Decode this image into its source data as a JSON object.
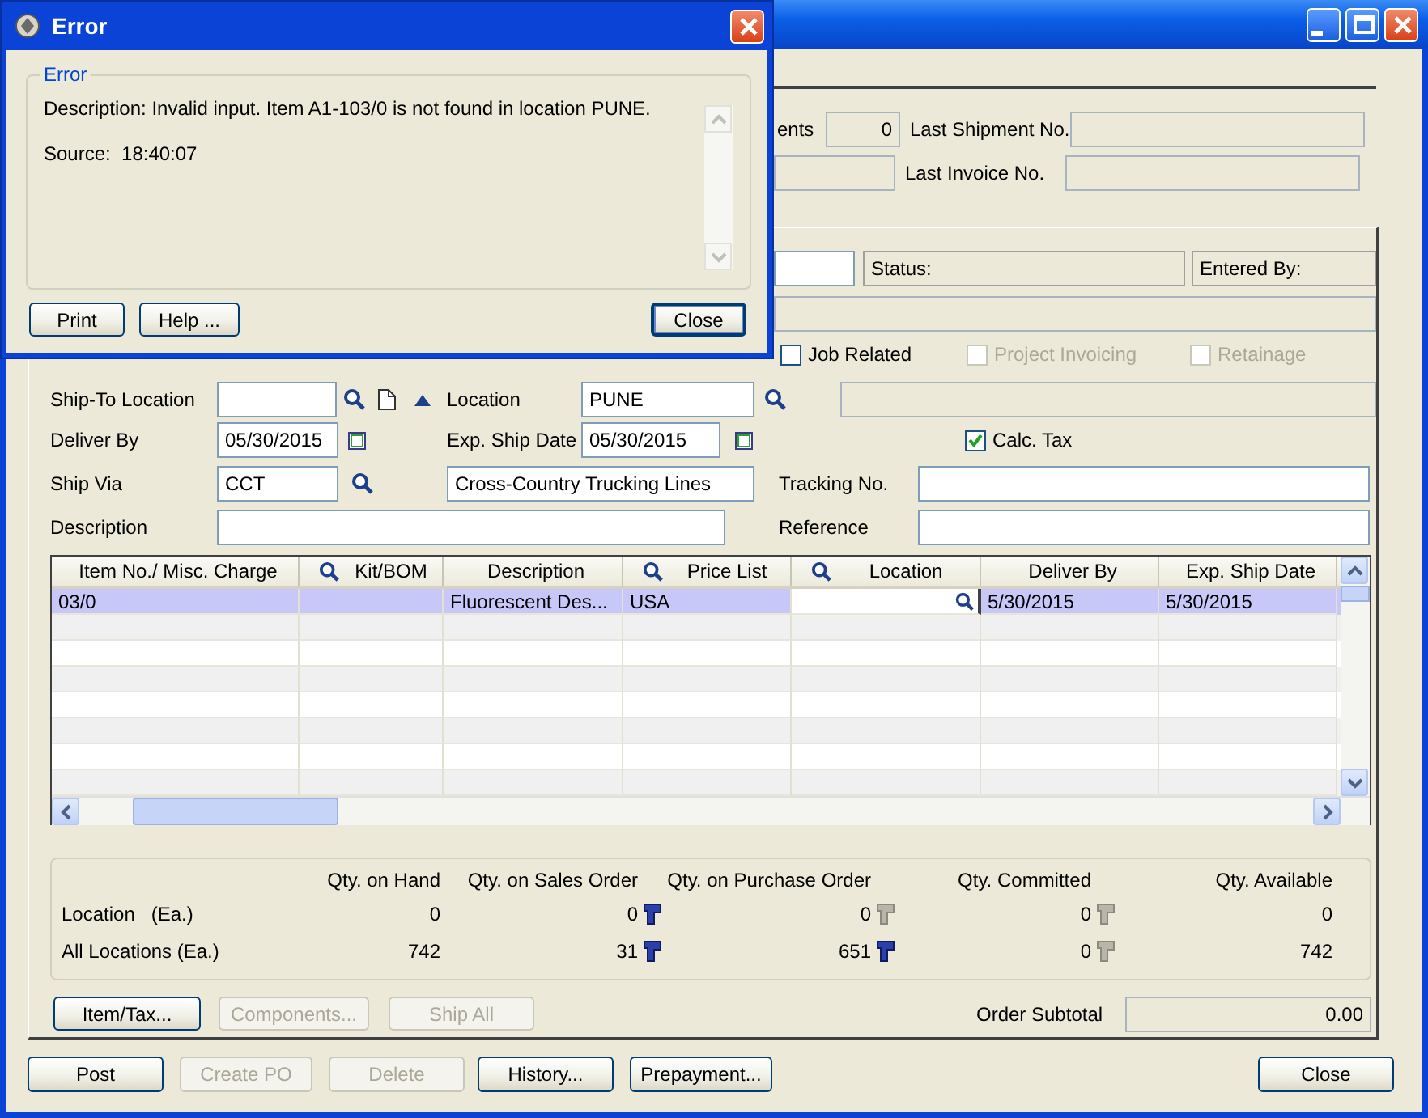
{
  "dialog": {
    "title": "Error",
    "group_title": "Error",
    "description": "Description: Invalid input. Item A1-103/0 is not found in location PUNE.",
    "source": "Source:  18:40:07",
    "buttons": [
      {
        "label": "Print",
        "default": false
      },
      {
        "label": "Help ...",
        "default": false
      },
      {
        "label": "Close",
        "default": true
      }
    ]
  },
  "header": {
    "shipments_label": "ents",
    "shipments_count": "0",
    "last_shipment_label": "Last Shipment No.",
    "last_invoice_label": "Last Invoice No."
  },
  "status_label": "Status:",
  "entered_by_label": "Entered By:",
  "checkboxes": [
    {
      "label": "Job Related",
      "checked": false,
      "disabled": false
    },
    {
      "label": "Project Invoicing",
      "checked": false,
      "disabled": true
    },
    {
      "label": "Retainage",
      "checked": false,
      "disabled": true
    }
  ],
  "ship_to_location": {
    "label": "Ship-To Location"
  },
  "location": {
    "label": "Location",
    "value": "PUNE"
  },
  "deliver_by": {
    "label": "Deliver By",
    "value": "05/30/2015"
  },
  "exp_ship_date": {
    "label": "Exp. Ship Date",
    "value": "05/30/2015"
  },
  "calc_tax": {
    "label": "Calc. Tax",
    "checked": true
  },
  "ship_via": {
    "label": "Ship Via",
    "value": "CCT",
    "name": "Cross-Country Trucking Lines"
  },
  "tracking_no": {
    "label": "Tracking No."
  },
  "description": {
    "label": "Description"
  },
  "reference": {
    "label": "Reference"
  },
  "grid": {
    "columns": [
      {
        "label": "Item No./ Misc. Charge",
        "search": false
      },
      {
        "label": "Kit/BOM",
        "search": true
      },
      {
        "label": "Description",
        "search": false
      },
      {
        "label": "Price List",
        "search": true
      },
      {
        "label": "Location",
        "search": true
      },
      {
        "label": "Deliver By",
        "search": false
      },
      {
        "label": "Exp. Ship Date",
        "search": false
      }
    ],
    "rows": [
      {
        "selected": true,
        "cells": [
          {
            "text": "03/0",
            "editing": false
          },
          {
            "editing": false
          },
          {
            "text": "Fluorescent Des...",
            "editing": false
          },
          {
            "text": "USA",
            "editing": false
          },
          {
            "editing": true
          },
          {
            "text": "5/30/2015",
            "editing": false
          },
          {
            "text": "5/30/2015",
            "editing": false
          }
        ]
      }
    ]
  },
  "qty": {
    "columns": [
      "Qty. on Hand",
      "Qty. on Sales Order",
      "Qty. on Purchase Order",
      "Qty. Committed",
      "Qty. Available"
    ],
    "rows": [
      {
        "label": "Location   (Ea.)",
        "values": [
          {
            "text": "0"
          },
          {
            "text": "0",
            "drill_enabled": true
          },
          {
            "text": "0",
            "drill_enabled": false
          },
          {
            "text": "0",
            "drill_enabled": false
          },
          {
            "text": "0"
          }
        ]
      },
      {
        "label": "All Locations (Ea.)",
        "values": [
          {
            "text": "742"
          },
          {
            "text": "31",
            "drill_enabled": true
          },
          {
            "text": "651",
            "drill_enabled": true
          },
          {
            "text": "0",
            "drill_enabled": false
          },
          {
            "text": "742"
          }
        ]
      }
    ]
  },
  "panel_buttons": [
    {
      "label": "Item/Tax...",
      "disabled": false
    },
    {
      "label": "Components...",
      "disabled": true
    },
    {
      "label": "Ship All",
      "disabled": true
    }
  ],
  "order_subtotal": {
    "label": "Order Subtotal",
    "value": "0.00"
  },
  "bottom_buttons": [
    {
      "label": "Post",
      "disabled": false
    },
    {
      "label": "Create PO",
      "disabled": true
    },
    {
      "label": "Delete",
      "disabled": true
    },
    {
      "label": "History...",
      "disabled": false
    },
    {
      "label": "Prepayment...",
      "disabled": false
    }
  ],
  "close_button": {
    "label": "Close",
    "disabled": false
  }
}
